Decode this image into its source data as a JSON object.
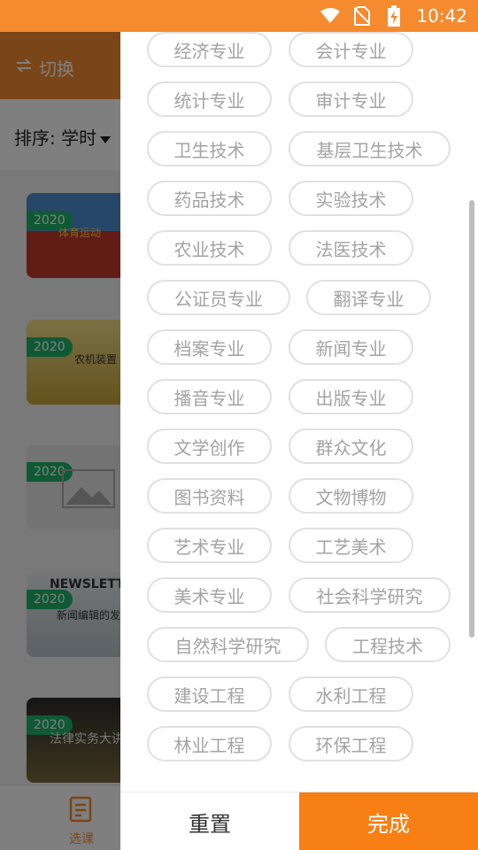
{
  "status_bar": {
    "time": "10:42",
    "icons": [
      "wifi-icon",
      "no-sim-icon",
      "battery-charging-icon"
    ]
  },
  "background": {
    "switch_label": "切换",
    "sort_label": "排序: 学时",
    "courses": [
      {
        "year": "2020",
        "thumb_text": "体育运动"
      },
      {
        "year": "2020",
        "thumb_text": "农机装置"
      },
      {
        "year": "2020",
        "thumb_text": ""
      },
      {
        "year": "2020",
        "thumb_text": "NEWSLETT",
        "thumb_sub": "新闻编辑的发展"
      },
      {
        "year": "2020",
        "thumb_text": "法律实务大讲"
      }
    ],
    "nav_label": "选课"
  },
  "filter": {
    "tags": [
      "经济专业",
      "会计专业",
      "统计专业",
      "审计专业",
      "卫生技术",
      "基层卫生技术",
      "药品技术",
      "实验技术",
      "农业技术",
      "法医技术",
      "公证员专业",
      "翻译专业",
      "档案专业",
      "新闻专业",
      "播音专业",
      "出版专业",
      "文学创作",
      "群众文化",
      "图书资料",
      "文物博物",
      "艺术专业",
      "工艺美术",
      "美术专业",
      "社会科学研究",
      "自然科学研究",
      "工程技术",
      "建设工程",
      "水利工程",
      "林业工程",
      "环保工程"
    ],
    "reset_label": "重置",
    "done_label": "完成"
  },
  "colors": {
    "accent": "#f58a2e",
    "done_button": "#f77f14",
    "badge": "#1fb36a",
    "tag_border": "#e0e0e0",
    "tag_text": "#a3a3a3"
  }
}
